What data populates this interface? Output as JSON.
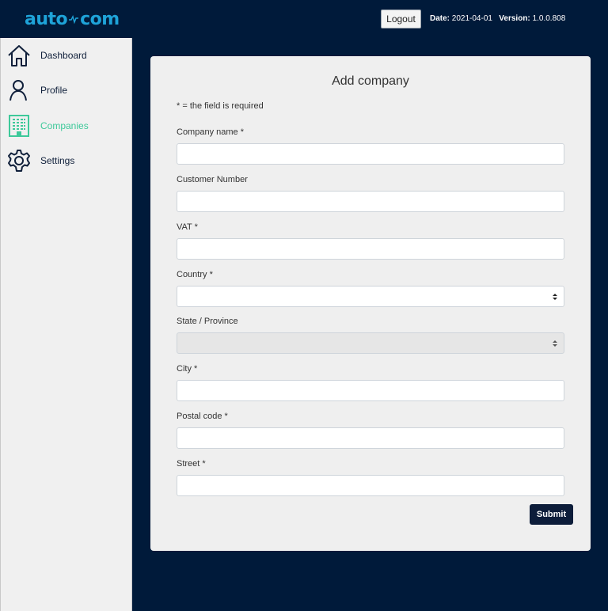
{
  "header": {
    "logo_left": "auto",
    "logo_right": "com",
    "logout_label": "Logout",
    "date_label": "Date:",
    "date_value": "2021-04-01",
    "version_label": "Version:",
    "version_value": "1.0.0.808"
  },
  "sidebar": {
    "items": [
      {
        "label": "Dashboard",
        "icon": "home-icon",
        "active": false
      },
      {
        "label": "Profile",
        "icon": "person-icon",
        "active": false
      },
      {
        "label": "Companies",
        "icon": "building-icon",
        "active": true
      },
      {
        "label": "Settings",
        "icon": "gear-icon",
        "active": false
      }
    ]
  },
  "form": {
    "title": "Add company",
    "required_note": "* = the field is required",
    "fields": {
      "company_name": {
        "label": "Company name *",
        "value": ""
      },
      "customer_number": {
        "label": "Customer Number",
        "value": ""
      },
      "vat": {
        "label": "VAT *",
        "value": ""
      },
      "country": {
        "label": "Country *",
        "value": ""
      },
      "state": {
        "label": "State / Province",
        "value": "",
        "disabled": true
      },
      "city": {
        "label": "City *",
        "value": ""
      },
      "postal_code": {
        "label": "Postal code *",
        "value": ""
      },
      "street": {
        "label": "Street *",
        "value": ""
      }
    },
    "submit_label": "Submit"
  },
  "colors": {
    "background": "#001a3a",
    "accent_logo": "#1ea3d8",
    "active_nav": "#3ec99a",
    "submit": "#0d1d3a"
  }
}
